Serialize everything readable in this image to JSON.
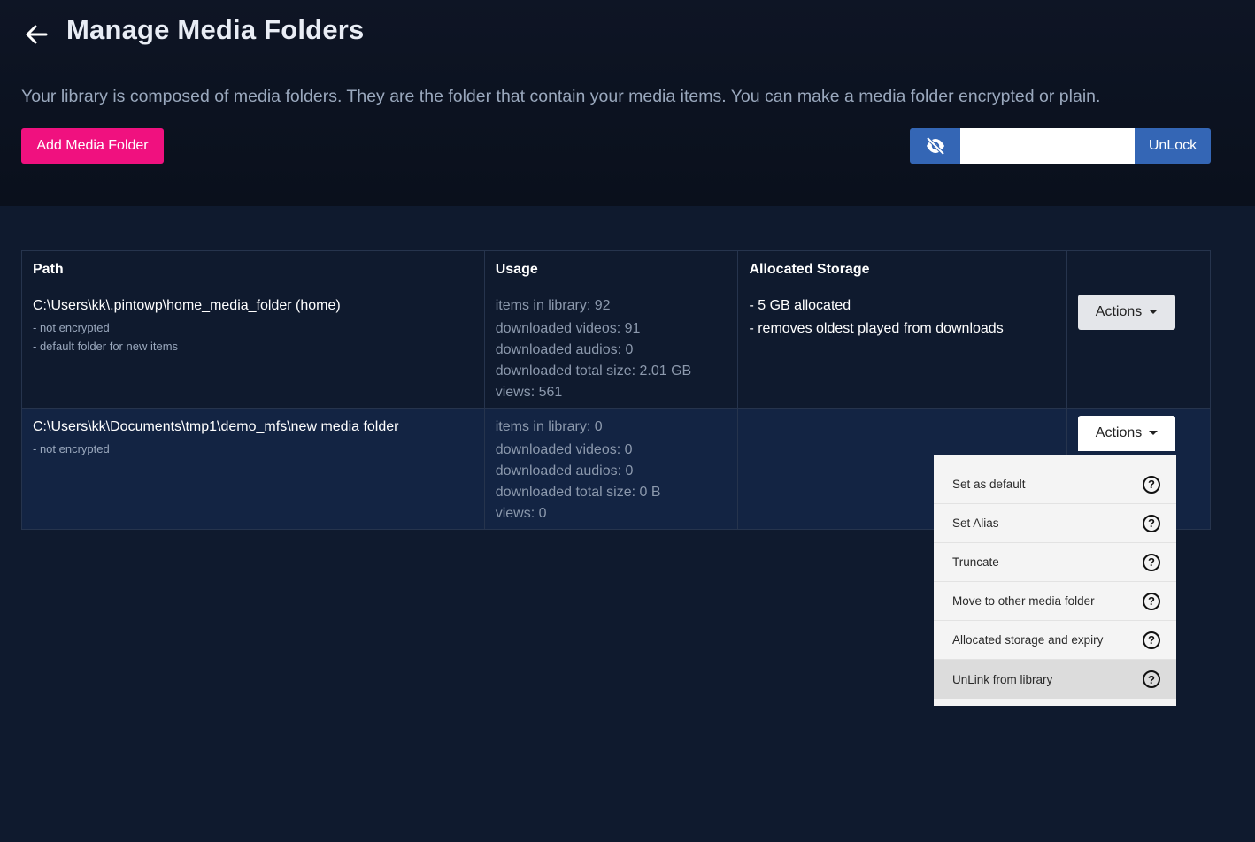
{
  "header": {
    "title": "Manage Media Folders",
    "description": "Your library is composed of media folders. They are the folder that contain your media items. You can make a media folder encrypted or plain.",
    "add_button_label": "Add Media Folder",
    "unlock_button_label": "UnLock",
    "password_value": "",
    "colors": {
      "primary_pink": "#f0117f",
      "accent_blue": "#3466b5"
    }
  },
  "table": {
    "columns": [
      "Path",
      "Usage",
      "Allocated Storage",
      ""
    ],
    "rows": [
      {
        "path": "C:\\Users\\kk\\.pintowp\\home_media_folder (home)",
        "notes": [
          "- not encrypted",
          "- default folder for new items"
        ],
        "usage": [
          "items in library: 92",
          "downloaded videos: 91",
          "downloaded audios: 0",
          "downloaded total size: 2.01 GB",
          "views: 561"
        ],
        "allocated": [
          "- 5 GB allocated",
          "- removes oldest played from downloads"
        ],
        "actions_label": "Actions"
      },
      {
        "path": "C:\\Users\\kk\\Documents\\tmp1\\demo_mfs\\new media folder",
        "notes": [
          "- not encrypted"
        ],
        "usage": [
          "items in library: 0",
          "downloaded videos: 0",
          "downloaded audios: 0",
          "downloaded total size: 0 B",
          "views: 0"
        ],
        "allocated": [],
        "actions_label": "Actions"
      }
    ]
  },
  "actions_menu": {
    "items": [
      {
        "label": "Set as default",
        "icon": "help-circle-icon"
      },
      {
        "label": "Set Alias",
        "icon": "help-circle-icon"
      },
      {
        "label": "Truncate",
        "icon": "help-circle-icon"
      },
      {
        "label": "Move to other media folder",
        "icon": "help-circle-icon"
      },
      {
        "label": "Allocated storage and expiry",
        "icon": "help-circle-icon"
      },
      {
        "label": "UnLink from library",
        "icon": "help-circle-icon",
        "highlighted": true
      }
    ]
  },
  "icons": {
    "back": "arrow-left-icon",
    "eye": "eye-slash-icon"
  }
}
